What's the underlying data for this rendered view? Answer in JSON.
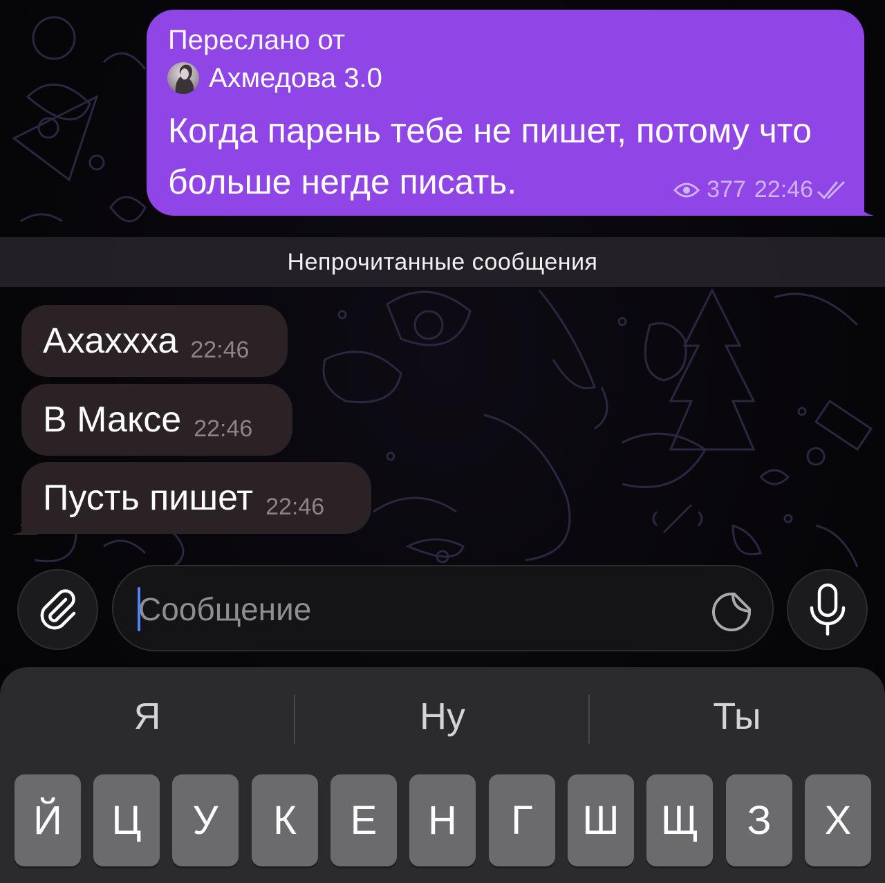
{
  "forwarded_message": {
    "forwarded_label": "Переслано от",
    "source_name": "Ахмедова 3.0",
    "text": "Когда парень тебе не пишет, потому что больше негде писать.",
    "views": "377",
    "time": "22:46",
    "status": "read"
  },
  "unread_divider": "Непрочитанные сообщения",
  "incoming_messages": [
    {
      "text": "Ахаххха",
      "time": "22:46"
    },
    {
      "text": "В Максе",
      "time": "22:46"
    },
    {
      "text": "Пусть пишет",
      "time": "22:46"
    }
  ],
  "composer": {
    "placeholder": "Сообщение",
    "value": ""
  },
  "keyboard": {
    "suggestions": [
      "Я",
      "Ну",
      "Ты"
    ],
    "keys_row1": [
      "Й",
      "Ц",
      "У",
      "К",
      "Е",
      "Н",
      "Г",
      "Ш",
      "Щ",
      "З",
      "Х"
    ]
  },
  "icons": {
    "attach": "paperclip-icon",
    "sticker": "sticker-icon",
    "mic": "microphone-icon",
    "views": "eye-icon",
    "status": "double-check-icon"
  },
  "colors": {
    "outgoing_bubble": "#9045e6",
    "incoming_bubble": "#2a2224",
    "background": "#060508"
  }
}
